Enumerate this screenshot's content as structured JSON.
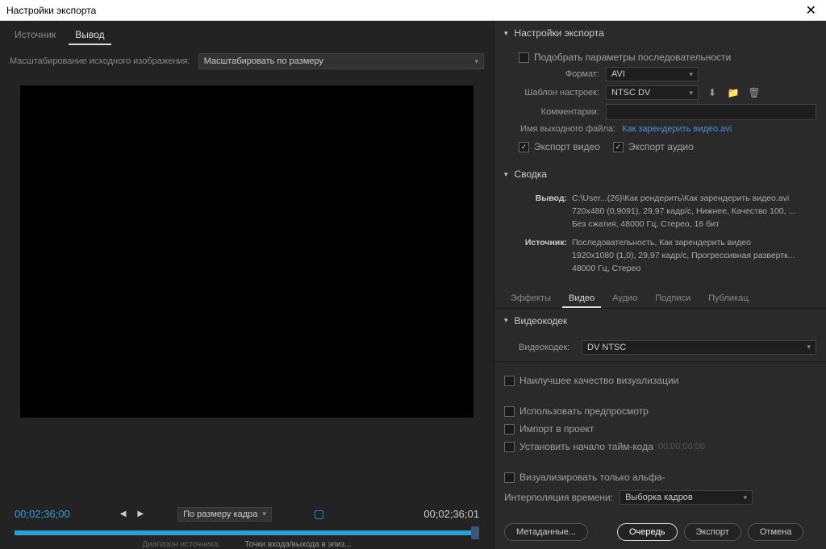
{
  "titlebar": {
    "title": "Настройки экспорта"
  },
  "left": {
    "tabs": {
      "source": "Источник",
      "output": "Вывод"
    },
    "scaling_label": "Масштабирование исходного изображения:",
    "scaling_value": "Масштабировать по размеру",
    "timecode_left": "00;02;36;00",
    "timecode_right": "00;02;36;01",
    "zoom_value": "По размеру кадра",
    "range_label": "Диапазон источника:",
    "range_value": "Точки входа/выхода в эпиз..."
  },
  "export": {
    "header": "Настройки экспорта",
    "match_sequence": "Подобрать параметры последовательности",
    "format_label": "Формат:",
    "format_value": "AVI",
    "preset_label": "Шаблон настроек:",
    "preset_value": "NTSC DV",
    "comments_label": "Комментарии:",
    "output_name_label": "Имя выходного файла:",
    "output_name_value": "Как зарендерить видео.avi",
    "export_video": "Экспорт видео",
    "export_audio": "Экспорт аудио"
  },
  "summary": {
    "header": "Сводка",
    "output_label": "Вывод:",
    "output_text": "C:\\User...(26)\\Как рендерить\\Как зарендерить видео.avi\n720x480 (0,9091), 29,97 кадр/с, Нижнее, Качество 100, ...\nБез сжатия, 48000 Гц, Стерео, 16 бит",
    "source_label": "Источник:",
    "source_text": "Последовательность, Как зарендерить видео\n1920x1080 (1,0), 29,97 кадр/с, Прогрессивная развертк...\n48000 Гц, Стерео"
  },
  "subtabs": {
    "effects": "Эффекты",
    "video": "Видео",
    "audio": "Аудио",
    "captions": "Подписи",
    "publish": "Публикац."
  },
  "videocodec": {
    "header": "Видеокодек",
    "label": "Видеокодек:",
    "value": "DV NTSC"
  },
  "bottom": {
    "max_quality": "Наилучшее качество визуализации",
    "use_previews": "Использовать предпросмотр",
    "import_project": "Импорт в проект",
    "set_start_tc": "Установить начало тайм-кода",
    "start_tc_value": "00;00;00;00",
    "render_alpha": "Визуализировать только альфа-",
    "time_interp_label": "Интерполяция времени:",
    "time_interp_value": "Выборка кадров"
  },
  "buttons": {
    "metadata": "Метаданные...",
    "queue": "Очередь",
    "export": "Экспорт",
    "cancel": "Отмена"
  }
}
